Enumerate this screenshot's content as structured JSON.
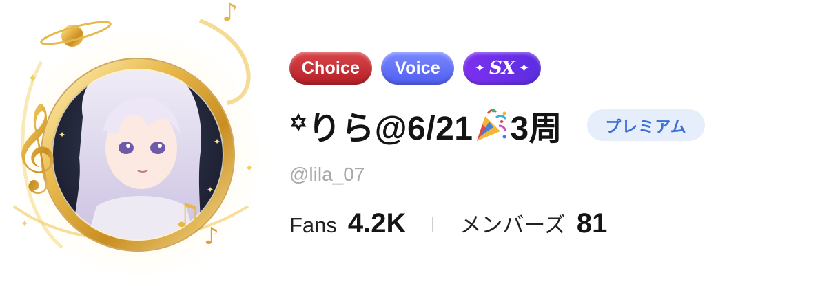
{
  "profile": {
    "badges": [
      {
        "label": "Choice",
        "color": "#c8282e"
      },
      {
        "label": "Voice",
        "color": "#5f6cf6"
      },
      {
        "label": "SX",
        "color": "#6a2fe8"
      }
    ],
    "display_name_prefix": "꙳りら@6/21",
    "display_name_suffix": "3周",
    "name_emoji": "party-popper-icon",
    "premium_label": "プレミアム",
    "handle": "@lila_07"
  },
  "stats": {
    "fans_label": "Fans",
    "fans_value": "4.2K",
    "members_label": "メンバーズ",
    "members_value": "81"
  },
  "colors": {
    "frame_gold": "#e8b84a",
    "premium_bg": "#e7eefb",
    "premium_text": "#3b6fd4",
    "handle_gray": "#a8a8a8"
  }
}
